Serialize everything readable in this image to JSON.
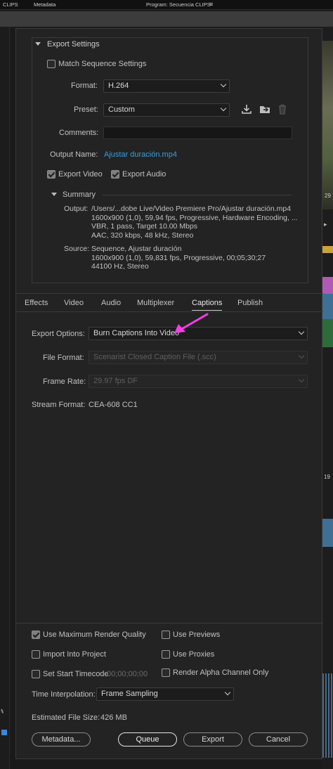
{
  "topbar": {
    "clips": "CLIPS",
    "metadata": "Metadata",
    "program": "Program: Secuencia CLIPS",
    "menu_icon": "hamburger-icon"
  },
  "export_settings": {
    "header": "Export Settings",
    "match_sequence": "Match Sequence Settings",
    "format_label": "Format:",
    "format_value": "H.264",
    "preset_label": "Preset:",
    "preset_value": "Custom",
    "comments_label": "Comments:",
    "comments_value": "",
    "output_name_label": "Output Name:",
    "output_name_value": "Ajustar duración.mp4",
    "export_video": "Export Video",
    "export_audio": "Export Audio",
    "export_video_checked": true,
    "export_audio_checked": true,
    "match_sequence_checked": false
  },
  "summary": {
    "header": "Summary",
    "output_label": "Output:",
    "output_lines": [
      "/Users/...dobe Live/Video Premiere Pro/Ajustar duración.mp4",
      "1600x900 (1,0), 59,94 fps, Progressive, Hardware Encoding, ...",
      "VBR, 1 pass, Target 10.00 Mbps",
      "AAC, 320 kbps, 48 kHz, Stereo"
    ],
    "source_label": "Source:",
    "source_lines": [
      "Sequence, Ajustar duración",
      "1600x900 (1,0), 59,831 fps, Progressive, 00;05;30;27",
      "44100 Hz, Stereo"
    ]
  },
  "tabs": [
    "Effects",
    "Video",
    "Audio",
    "Multiplexer",
    "Captions",
    "Publish"
  ],
  "active_tab": "Captions",
  "captions": {
    "export_options_label": "Export Options:",
    "export_options_value": "Burn Captions Into Video",
    "file_format_label": "File Format:",
    "file_format_value": "Scenarist Closed Caption File (.scc)",
    "frame_rate_label": "Frame Rate:",
    "frame_rate_value": "29.97 fps DF",
    "stream_format_label": "Stream Format:",
    "stream_format_value": "CEA-608 CC1"
  },
  "options": {
    "max_render_quality": "Use Maximum Render Quality",
    "use_previews": "Use Previews",
    "import_into_project": "Import Into Project",
    "use_proxies": "Use Proxies",
    "set_start_timecode": "Set Start Timecode",
    "start_timecode_value": "00;00;00;00",
    "render_alpha": "Render Alpha Channel Only",
    "max_render_quality_checked": true,
    "use_previews_checked": false,
    "import_into_project_checked": false,
    "use_proxies_checked": false,
    "set_start_timecode_checked": false,
    "render_alpha_checked": false
  },
  "time_interpolation": {
    "label": "Time Interpolation:",
    "value": "Frame Sampling"
  },
  "file_size": {
    "label": "Estimated File Size:",
    "value": "426 MB"
  },
  "buttons": {
    "metadata": "Metadata...",
    "queue": "Queue",
    "export": "Export",
    "cancel": "Cancel"
  },
  "colors": {
    "accent_link": "#3a9de0",
    "arrow_magenta": "#f23fe6",
    "panel_bg": "#232323"
  },
  "right_strip": {
    "fragments": [
      "29",
      "19"
    ]
  }
}
